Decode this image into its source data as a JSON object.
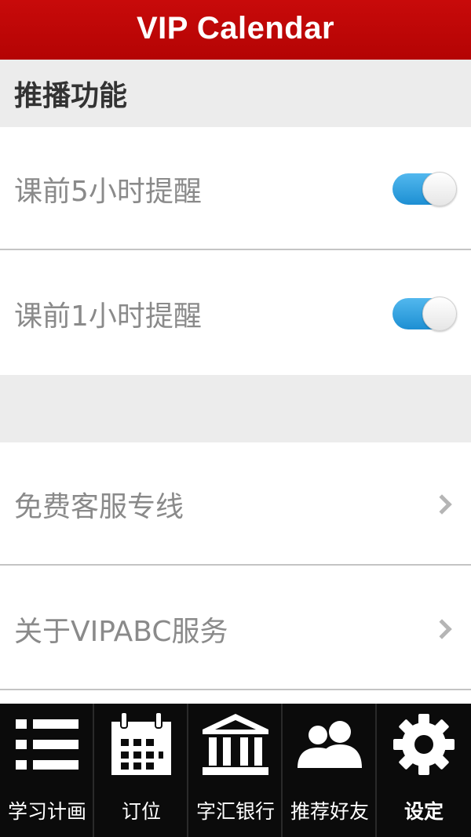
{
  "header": {
    "title": "VIP Calendar",
    "background": "#c00000"
  },
  "push_section": {
    "title": "推播功能",
    "items": [
      {
        "label": "课前5小时提醒",
        "enabled": true
      },
      {
        "label": "课前1小时提醒",
        "enabled": true
      }
    ]
  },
  "links": [
    {
      "label": "免费客服专线",
      "icon": "chevron-right-icon"
    },
    {
      "label": "关于VIPABC服务",
      "icon": "chevron-right-icon"
    }
  ],
  "tabs": [
    {
      "label": "学习计画",
      "icon": "list-icon"
    },
    {
      "label": "订位",
      "icon": "calendar-icon"
    },
    {
      "label": "字汇银行",
      "icon": "bank-icon"
    },
    {
      "label": "推荐好友",
      "icon": "friends-icon"
    },
    {
      "label": "设定",
      "icon": "gear-icon",
      "active": true
    }
  ],
  "colors": {
    "toggle_on": "#2a9ce0",
    "tabbar": "#0b0b0b",
    "section_bg": "#ececec"
  }
}
